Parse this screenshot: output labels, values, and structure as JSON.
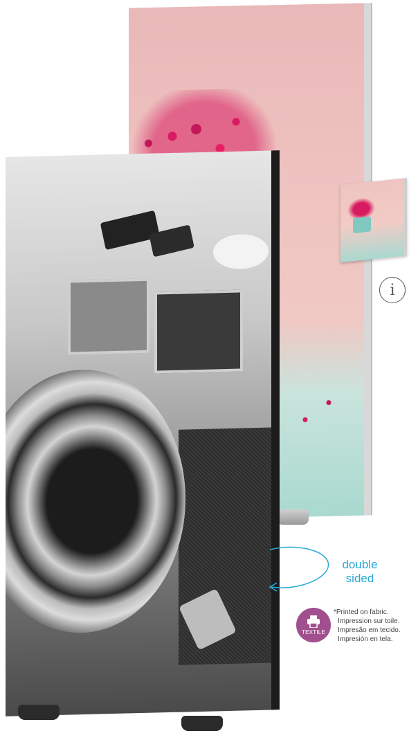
{
  "info_icon": {
    "glyph": "i",
    "icon": "info-icon"
  },
  "double_sided": {
    "line1": "double",
    "line2": "sided",
    "color": "#29a9d6"
  },
  "textile_badge": {
    "label": "TEXTILE",
    "icon": "printer-icon",
    "color": "#a14f8e"
  },
  "print_notes": [
    "*Printed on fabric.",
    "Impression sur toile.",
    "Impresão em tecido.",
    "Impresión en tela."
  ]
}
